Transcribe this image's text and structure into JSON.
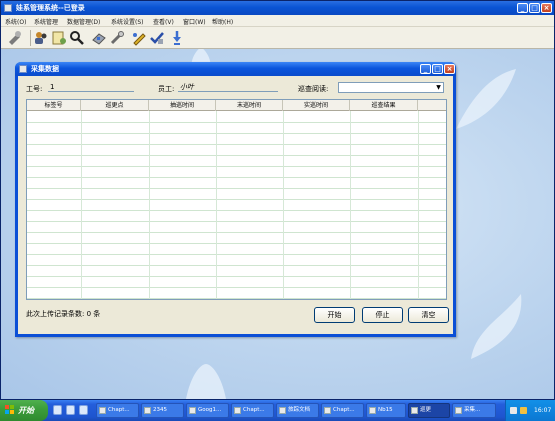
{
  "window": {
    "title": "娃系管理系统--已登录"
  },
  "menu": [
    {
      "label": "系统(O)"
    },
    {
      "label": "系统管理"
    },
    {
      "label": "数据管理(D)"
    },
    {
      "label": "系统设置(S)"
    },
    {
      "label": "查看(V)"
    },
    {
      "label": "窗口(W)"
    },
    {
      "label": "帮助(H)"
    }
  ],
  "toolbar": {
    "icons": [
      "settings-icon",
      "users-icon",
      "notebook-icon",
      "search-icon",
      "device-icon",
      "tools-icon",
      "edit-icon",
      "check-icon",
      "info-icon"
    ]
  },
  "dialog": {
    "title": "采集数据",
    "job_no_label": "工号:",
    "job_no_value": "1",
    "employee_label": "员工:",
    "employee_value": "小叶",
    "reader_label": "巡查阅读:",
    "reader_value": "",
    "columns": [
      "标签号",
      "巡更点",
      "抽巡时间",
      "末巡时间",
      "实巡时间",
      "巡查结果"
    ],
    "upload_count_label": "此次上传记录条数:",
    "upload_count_value": "0",
    "upload_count_unit": "条",
    "buttons": {
      "start": "开始",
      "stop": "停止",
      "clear": "清空"
    }
  },
  "taskbar": {
    "start_label": "开始",
    "tasks": [
      {
        "label": "Chapt..."
      },
      {
        "label": "2345"
      },
      {
        "label": "Goog1..."
      },
      {
        "label": "Chapt..."
      },
      {
        "label": "旅踪文档"
      },
      {
        "label": "Chapt..."
      },
      {
        "label": "Nb15"
      },
      {
        "label": "巡更"
      },
      {
        "label": "采集..."
      }
    ],
    "clock": "16:07"
  }
}
